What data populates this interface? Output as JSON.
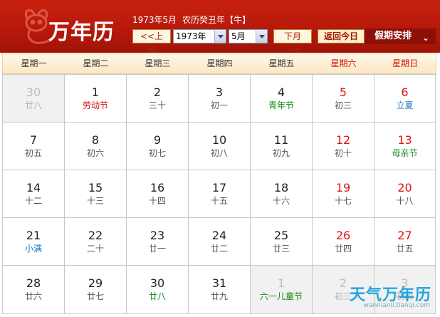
{
  "header": {
    "brand": "万年历",
    "date_text": "1973年5月",
    "lunar_text": "农历癸丑年【牛】",
    "prev_month": "<<上月",
    "year_select": "1973年",
    "month_select": "5月",
    "next_month": "下月>>",
    "today": "返回今日",
    "holiday": "假期安排"
  },
  "colors": {
    "header_red": "#c8220f",
    "weekend_red": "#e0140f",
    "festival_red": "#d2140e",
    "term_green": "#138a16",
    "solar_blue": "#1f7ac4"
  },
  "weekdays": [
    "星期一",
    "星期二",
    "星期三",
    "星期四",
    "星期五",
    "星期六",
    "星期日"
  ],
  "weeks": [
    [
      {
        "day": "30",
        "sub": "廿八",
        "other": true
      },
      {
        "day": "1",
        "sub": "劳动节",
        "sub_color": "red"
      },
      {
        "day": "2",
        "sub": "三十"
      },
      {
        "day": "3",
        "sub": "初一"
      },
      {
        "day": "4",
        "sub": "青年节",
        "sub_color": "green"
      },
      {
        "day": "5",
        "sub": "初三",
        "weekend": true
      },
      {
        "day": "6",
        "sub": "立夏",
        "sub_color": "blue",
        "weekend": true
      }
    ],
    [
      {
        "day": "7",
        "sub": "初五"
      },
      {
        "day": "8",
        "sub": "初六"
      },
      {
        "day": "9",
        "sub": "初七"
      },
      {
        "day": "10",
        "sub": "初八"
      },
      {
        "day": "11",
        "sub": "初九"
      },
      {
        "day": "12",
        "sub": "初十",
        "weekend": true
      },
      {
        "day": "13",
        "sub": "母亲节",
        "sub_color": "green",
        "weekend": true
      }
    ],
    [
      {
        "day": "14",
        "sub": "十二"
      },
      {
        "day": "15",
        "sub": "十三"
      },
      {
        "day": "16",
        "sub": "十四"
      },
      {
        "day": "17",
        "sub": "十五"
      },
      {
        "day": "18",
        "sub": "十六"
      },
      {
        "day": "19",
        "sub": "十七",
        "weekend": true
      },
      {
        "day": "20",
        "sub": "十八",
        "weekend": true
      }
    ],
    [
      {
        "day": "21",
        "sub": "小满",
        "sub_color": "blue"
      },
      {
        "day": "22",
        "sub": "二十"
      },
      {
        "day": "23",
        "sub": "廿一"
      },
      {
        "day": "24",
        "sub": "廿二"
      },
      {
        "day": "25",
        "sub": "廿三"
      },
      {
        "day": "26",
        "sub": "廿四",
        "weekend": true
      },
      {
        "day": "27",
        "sub": "廿五",
        "weekend": true
      }
    ],
    [
      {
        "day": "28",
        "sub": "廿六"
      },
      {
        "day": "29",
        "sub": "廿七"
      },
      {
        "day": "30",
        "sub": "廿八",
        "sub_color": "green"
      },
      {
        "day": "31",
        "sub": "廿九"
      },
      {
        "day": "1",
        "sub": "六一儿童节",
        "sub_color": "green",
        "other": true
      },
      {
        "day": "2",
        "sub": "初三",
        "other": true
      },
      {
        "day": "3",
        "sub": "初四",
        "other": true
      }
    ]
  ],
  "watermark": {
    "title": "天气万年历",
    "url": "wannianli.tianqi.com"
  }
}
